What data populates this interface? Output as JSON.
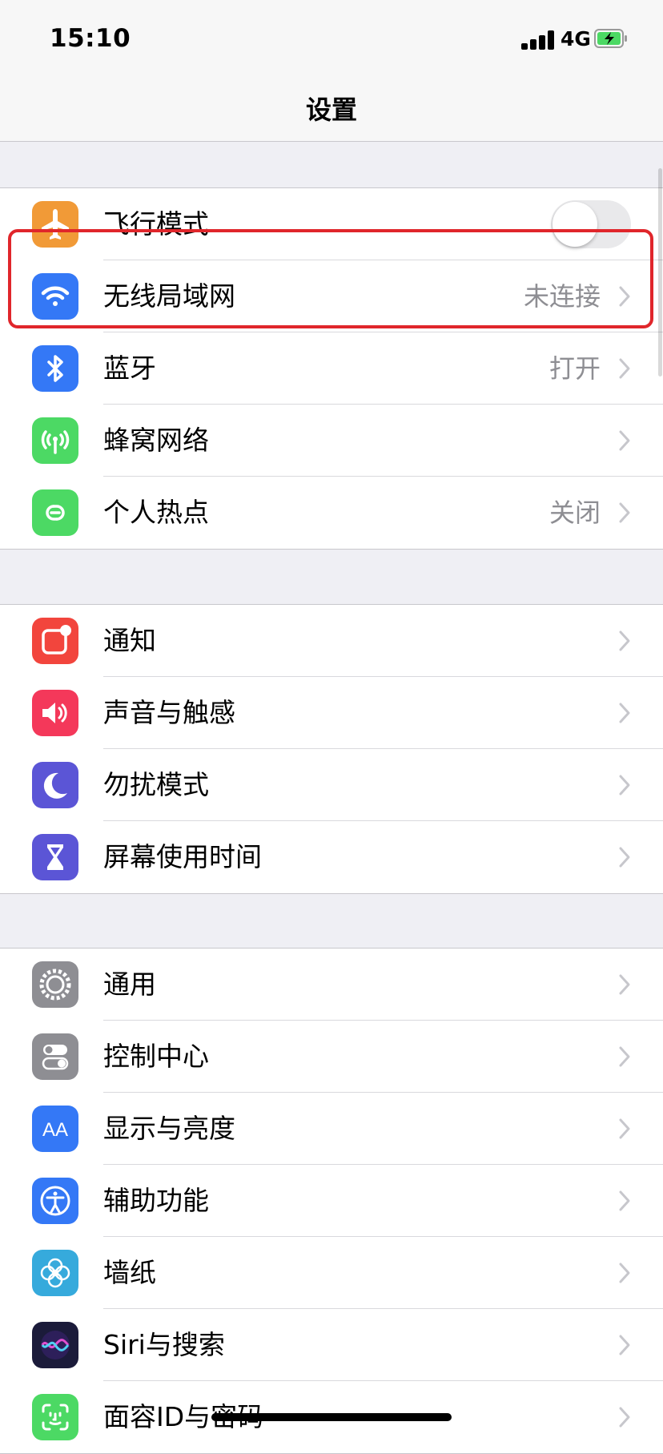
{
  "status_bar": {
    "time": "15:10",
    "network": "4G"
  },
  "nav": {
    "title": "设置"
  },
  "groups": [
    {
      "items": [
        {
          "label": "飞行模式",
          "icon": "airplane-icon",
          "color": "#f19a37",
          "toggle": "off"
        },
        {
          "label": "无线局域网",
          "value": "未连接",
          "icon": "wifi-icon",
          "color": "#3478f6",
          "highlighted": true
        },
        {
          "label": "蓝牙",
          "value": "打开",
          "icon": "bluetooth-icon",
          "color": "#3478f6"
        },
        {
          "label": "蜂窝网络",
          "icon": "cellular-icon",
          "color": "#4cd964"
        },
        {
          "label": "个人热点",
          "value": "关闭",
          "icon": "hotspot-icon",
          "color": "#4cd964"
        }
      ]
    },
    {
      "items": [
        {
          "label": "通知",
          "icon": "notifications-icon",
          "color": "#f2453d"
        },
        {
          "label": "声音与触感",
          "icon": "sound-icon",
          "color": "#f4385a"
        },
        {
          "label": "勿扰模式",
          "icon": "moon-icon",
          "color": "#5b55d6"
        },
        {
          "label": "屏幕使用时间",
          "icon": "hourglass-icon",
          "color": "#5b55d6"
        }
      ]
    },
    {
      "items": [
        {
          "label": "通用",
          "icon": "gear-icon",
          "color": "#8e8e93"
        },
        {
          "label": "控制中心",
          "icon": "control-center-icon",
          "color": "#8e8e93"
        },
        {
          "label": "显示与亮度",
          "icon": "display-brightness-icon",
          "color": "#3478f6",
          "glyph": "AA"
        },
        {
          "label": "辅助功能",
          "icon": "accessibility-icon",
          "color": "#3478f6"
        },
        {
          "label": "墙纸",
          "icon": "wallpaper-icon",
          "color": "#36aadc"
        },
        {
          "label": "Siri与搜索",
          "icon": "siri-icon",
          "color": "#1b1b3a"
        },
        {
          "label": "面容ID与密码",
          "icon": "face-id-icon",
          "color": "#4cd964"
        }
      ]
    }
  ]
}
